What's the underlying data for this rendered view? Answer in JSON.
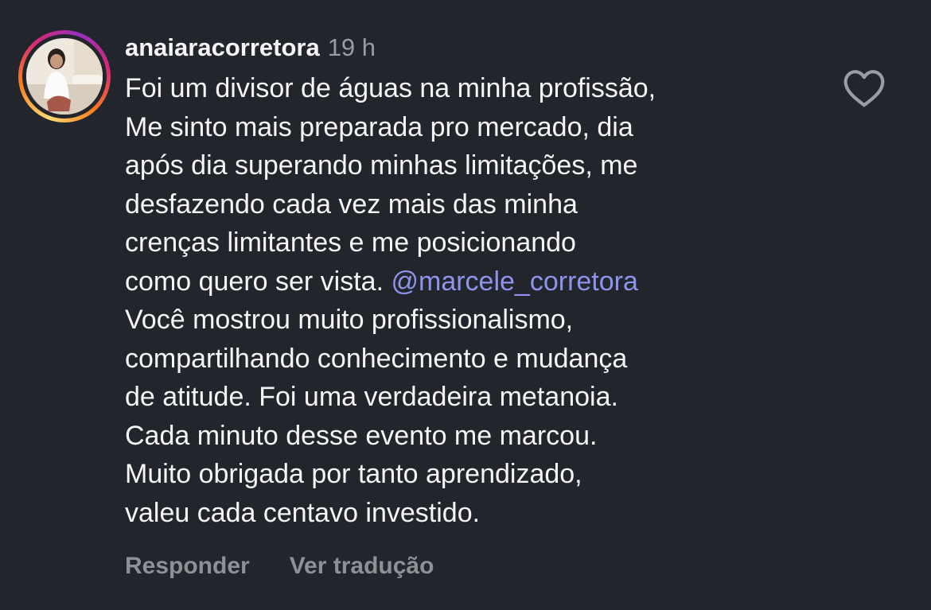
{
  "comment": {
    "username": "anaiaracorretora",
    "timestamp": "19 h",
    "text_before_mention": "Foi um divisor de águas na minha profissão,\nMe sinto mais preparada pro mercado, dia\napós dia superando minhas limitações, me\ndesfazendo cada vez mais das minha\ncrenças limitantes e me posicionando\ncomo quero ser vista. ",
    "mention": "@marcele_corretora",
    "text_after_mention": "\nVocê mostrou muito profissionalismo,\ncompartilhando conhecimento e mudança\nde atitude. Foi uma verdadeira metanoia.\nCada minuto desse evento me marcou.\nMuito obrigada por tanto aprendizado,\nvaleu cada centavo investido.",
    "like_icon": "heart-outline-icon"
  },
  "actions": {
    "reply_label": "Responder",
    "translate_label": "Ver tradução"
  },
  "colors": {
    "background": "#23252c",
    "text": "#f5f5f5",
    "secondary": "#9a9ca3",
    "mention": "#8e94ec"
  }
}
